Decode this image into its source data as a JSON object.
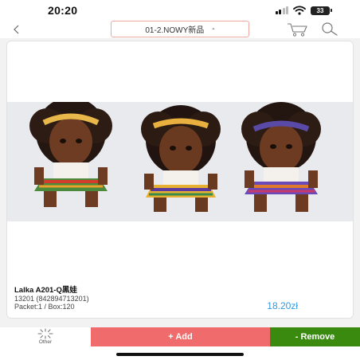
{
  "status_bar": {
    "time": "20:20",
    "battery": "33",
    "icons": [
      "signal-icon",
      "wifi-icon",
      "battery-icon"
    ]
  },
  "nav": {
    "back_icon": "chevron-left-icon",
    "category": "01-2.NOWY新品",
    "caret": "-",
    "cart_icon": "cart-icon",
    "search_icon": "search-icon"
  },
  "product": {
    "name": "Lalka A201-Q黑娃",
    "code": "13201 (842894713201)",
    "packet": "Packet:1 / Box:120",
    "price": "18.20zł",
    "image": "three dolls with curly hair, headbands and patterned skirts"
  },
  "actions": {
    "other_icon": "sparkle-icon",
    "other_label": "Other",
    "add_label": "+ Add",
    "remove_label": "- Remove",
    "add_color": "#f06b6b",
    "remove_color": "#3a8a10"
  },
  "colors": {
    "accent_price": "#2e9ae0",
    "select_border": "#f0a8a3"
  }
}
